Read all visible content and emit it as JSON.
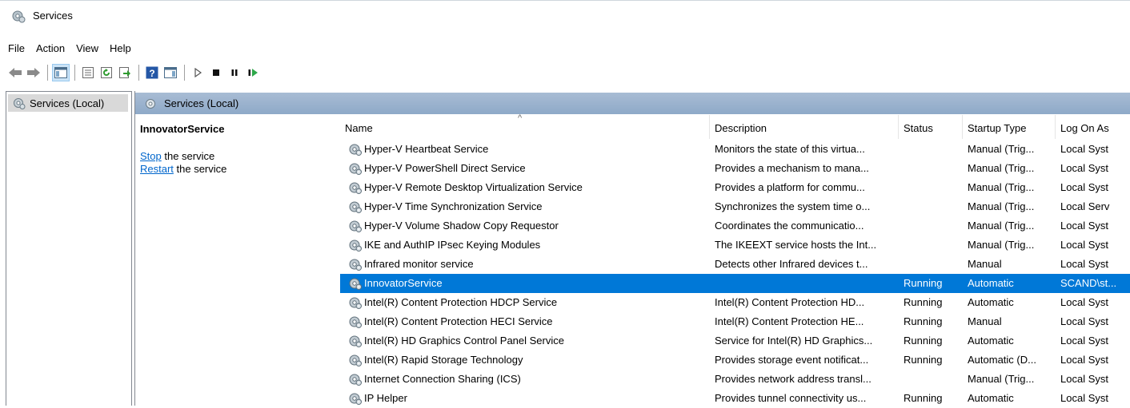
{
  "window": {
    "title": "Services"
  },
  "menu": [
    "File",
    "Action",
    "View",
    "Help"
  ],
  "toolbar": {
    "icons": [
      "back-icon",
      "forward-icon",
      "show-hide-console-tree-icon",
      "properties-icon",
      "refresh-icon",
      "export-list-icon",
      "help-icon",
      "show-action-pane-icon",
      "start-service-icon",
      "stop-service-icon",
      "pause-service-icon",
      "resume-service-icon"
    ]
  },
  "tree": {
    "item_label": "Services (Local)"
  },
  "main": {
    "header_title": "Services (Local)"
  },
  "extended": {
    "service_name": "InnovatorService",
    "stop_link": "Stop",
    "stop_suffix": " the service",
    "restart_link": "Restart",
    "restart_suffix": " the service"
  },
  "columns": {
    "name": "Name",
    "description": "Description",
    "status": "Status",
    "startup": "Startup Type",
    "logon": "Log On As",
    "sort_indicator": "^"
  },
  "rows": [
    {
      "name": "Hyper-V Heartbeat Service",
      "description": "Monitors the state of this virtua...",
      "status": "",
      "startup": "Manual (Trig...",
      "logon": "Local Syst"
    },
    {
      "name": "Hyper-V PowerShell Direct Service",
      "description": "Provides a mechanism to mana...",
      "status": "",
      "startup": "Manual (Trig...",
      "logon": "Local Syst"
    },
    {
      "name": "Hyper-V Remote Desktop Virtualization Service",
      "description": "Provides a platform for commu...",
      "status": "",
      "startup": "Manual (Trig...",
      "logon": "Local Syst"
    },
    {
      "name": "Hyper-V Time Synchronization Service",
      "description": "Synchronizes the system time o...",
      "status": "",
      "startup": "Manual (Trig...",
      "logon": "Local Serv"
    },
    {
      "name": "Hyper-V Volume Shadow Copy Requestor",
      "description": "Coordinates the communicatio...",
      "status": "",
      "startup": "Manual (Trig...",
      "logon": "Local Syst"
    },
    {
      "name": "IKE and AuthIP IPsec Keying Modules",
      "description": "The IKEEXT service hosts the Int...",
      "status": "",
      "startup": "Manual (Trig...",
      "logon": "Local Syst"
    },
    {
      "name": "Infrared monitor service",
      "description": "Detects other Infrared devices t...",
      "status": "",
      "startup": "Manual",
      "logon": "Local Syst"
    },
    {
      "name": "InnovatorService",
      "description": "",
      "status": "Running",
      "startup": "Automatic",
      "logon": "SCAND\\st...",
      "selected": true
    },
    {
      "name": "Intel(R) Content Protection HDCP Service",
      "description": "Intel(R) Content Protection HD...",
      "status": "Running",
      "startup": "Automatic",
      "logon": "Local Syst"
    },
    {
      "name": "Intel(R) Content Protection HECI Service",
      "description": "Intel(R) Content Protection HE...",
      "status": "Running",
      "startup": "Manual",
      "logon": "Local Syst"
    },
    {
      "name": "Intel(R) HD Graphics Control Panel Service",
      "description": "Service for Intel(R) HD Graphics...",
      "status": "Running",
      "startup": "Automatic",
      "logon": "Local Syst"
    },
    {
      "name": "Intel(R) Rapid Storage Technology",
      "description": "Provides storage event notificat...",
      "status": "Running",
      "startup": "Automatic (D...",
      "logon": "Local Syst"
    },
    {
      "name": "Internet Connection Sharing (ICS)",
      "description": "Provides network address transl...",
      "status": "",
      "startup": "Manual (Trig...",
      "logon": "Local Syst"
    },
    {
      "name": "IP Helper",
      "description": "Provides tunnel connectivity us...",
      "status": "Running",
      "startup": "Automatic",
      "logon": "Local Syst"
    }
  ]
}
